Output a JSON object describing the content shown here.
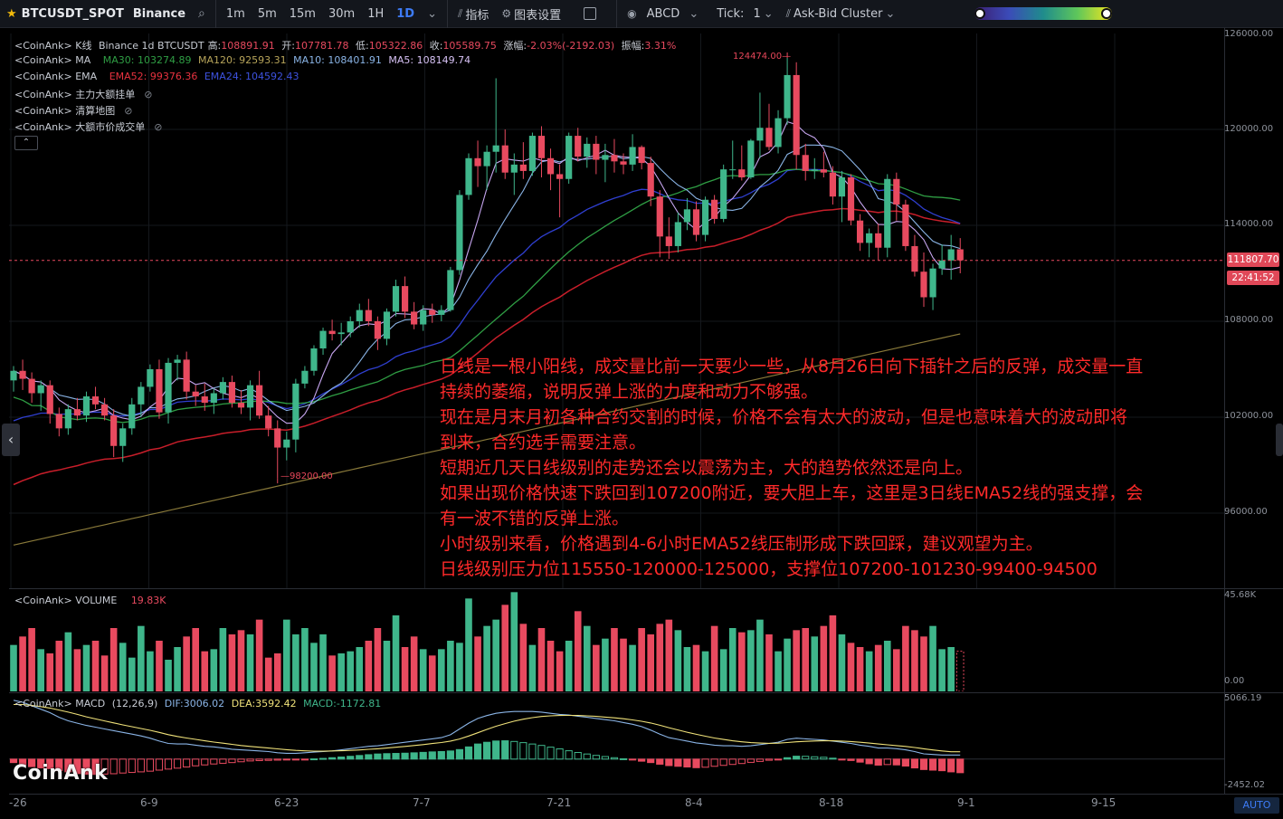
{
  "toolbar": {
    "symbol": "BTCUSDT_SPOT",
    "exchange": "Binance",
    "intervals": [
      "1m",
      "5m",
      "15m",
      "30m",
      "1H",
      "1D"
    ],
    "active_interval": "1D",
    "indicators_label": "指标",
    "chart_settings_label": "图表设置",
    "layout_label": "ABCD",
    "tick_label": "Tick:",
    "tick_value": "1",
    "cluster_label": "Ask-Bid Cluster"
  },
  "legend": {
    "kline": {
      "source": "<CoinAnk> K线",
      "title": "Binance 1d BTCUSDT",
      "high_label": "高:",
      "high": "108891.91",
      "open_label": "开:",
      "open": "107781.78",
      "low_label": "低:",
      "low": "105322.86",
      "close_label": "收:",
      "close": "105589.75",
      "change_label": "涨幅:",
      "change": "-2.03%(-2192.03)",
      "amp_label": "振幅:",
      "amp": "3.31%"
    },
    "ma": {
      "source": "<CoinAnk> MA",
      "ma30": "MA30: 103274.89",
      "ma120": "MA120: 92593.31",
      "ma10": "MA10: 108401.91",
      "ma5": "MA5: 108149.74"
    },
    "ema": {
      "source": "<CoinAnk> EMA",
      "ema52": "EMA52: 99376.36",
      "ema24": "EMA24: 104592.43"
    },
    "hidden": [
      "<CoinAnk> 主力大额挂单",
      "<CoinAnk> 清算地图",
      "<CoinAnk> 大额市价成交单"
    ],
    "volume": {
      "source": "<CoinAnk> VOLUME",
      "value": "19.83K"
    },
    "macd": {
      "source": "<CoinAnk> MACD",
      "params": "(12,26,9)",
      "dif": "DIF:3006.02",
      "dea": "DEA:3592.42",
      "macd": "MACD:-1172.81"
    }
  },
  "price_axis": [
    "126000.00",
    "120000.00",
    "114000.00",
    "108000.00",
    "102000.00",
    "96000.00"
  ],
  "volume_axis": [
    "45.68K",
    "0.00"
  ],
  "macd_axis": [
    "5066.19",
    "-2452.02"
  ],
  "current_price": "111807.70",
  "countdown": "22:41:52",
  "peak_high": "124474.00",
  "trough_low": "98200.00",
  "x_axis": [
    "-26",
    "6-9",
    "6-23",
    "7-7",
    "7-21",
    "8-4",
    "8-18",
    "9-1",
    "9-15"
  ],
  "annotation_lines": [
    "日线是一根小阳线，成交量比前一天要少一些，从8月26日向下插针之后的反弹，成交量一直",
    "持续的萎缩，说明反弹上涨的力度和动力不够强。",
    "现在是月末月初各种合约交割的时候，价格不会有太大的波动，但是也意味着大的波动即将",
    "到来，合约选手需要注意。",
    "短期近几天日线级别的走势还会以震荡为主，大的趋势依然还是向上。",
    "如果出现价格快速下跌回到107200附近，要大胆上车，这里是3日线EMA52线的强支撑，会",
    "有一波不错的反弹上涨。",
    "小时级别来看，价格遇到4-6小时EMA52线压制形成下跌回踩，建议观望为主。",
    "日线级别压力位115550-120000-125000，支撑位107200-101230-99400-94500"
  ],
  "watermark": "CoinAnk",
  "auto_label": "AUTO",
  "colors": {
    "up": "#3fb68b",
    "down": "#e84a5f",
    "ma5": "#c7a6f0",
    "ma10": "#8ab4e6",
    "ma30": "#2f9e44",
    "ma120": "#8a7a3a",
    "ema24": "#2f3fd0",
    "ema52": "#c81e2a",
    "annotation": "#ff2a2a"
  },
  "candles": [
    [
      104300,
      105200,
      103600,
      104900
    ],
    [
      104900,
      105600,
      103700,
      104400
    ],
    [
      104400,
      104800,
      102900,
      103500
    ],
    [
      103500,
      104300,
      102400,
      104000
    ],
    [
      104000,
      104300,
      101600,
      102200
    ],
    [
      102200,
      102600,
      100800,
      101300
    ],
    [
      101300,
      102800,
      100900,
      102500
    ],
    [
      102500,
      103200,
      101800,
      102100
    ],
    [
      102100,
      103600,
      101700,
      103300
    ],
    [
      103300,
      103900,
      102500,
      102800
    ],
    [
      102800,
      103200,
      101800,
      102100
    ],
    [
      102100,
      102500,
      99500,
      100200
    ],
    [
      100200,
      101600,
      99200,
      101300
    ],
    [
      101300,
      103200,
      100900,
      102800
    ],
    [
      102800,
      104200,
      102000,
      103900
    ],
    [
      103900,
      105300,
      103600,
      105000
    ],
    [
      105000,
      105600,
      101900,
      102300
    ],
    [
      102300,
      105700,
      101600,
      105400
    ],
    [
      105400,
      105900,
      104300,
      105600
    ],
    [
      105600,
      106100,
      103100,
      103600
    ],
    [
      103600,
      104000,
      102700,
      103300
    ],
    [
      103300,
      104100,
      102400,
      102900
    ],
    [
      102900,
      103800,
      102200,
      103500
    ],
    [
      103500,
      104500,
      103100,
      104200
    ],
    [
      104200,
      104600,
      102600,
      102900
    ],
    [
      102900,
      103700,
      102200,
      102600
    ],
    [
      102600,
      104300,
      101800,
      104000
    ],
    [
      104000,
      104900,
      101900,
      102100
    ],
    [
      102100,
      102700,
      100800,
      101300
    ],
    [
      101300,
      101800,
      98200,
      100100
    ],
    [
      100100,
      101100,
      99300,
      100600
    ],
    [
      100600,
      104400,
      99800,
      104100
    ],
    [
      104100,
      105200,
      103800,
      104900
    ],
    [
      104900,
      106500,
      104600,
      106300
    ],
    [
      106300,
      107600,
      105900,
      107400
    ],
    [
      107400,
      108100,
      106800,
      107200
    ],
    [
      107200,
      107900,
      106500,
      107300
    ],
    [
      107300,
      108300,
      107000,
      108000
    ],
    [
      108000,
      109100,
      107600,
      108700
    ],
    [
      108700,
      109400,
      107700,
      108000
    ],
    [
      108000,
      108300,
      106200,
      106900
    ],
    [
      106900,
      108800,
      106500,
      108600
    ],
    [
      108600,
      110600,
      108300,
      110200
    ],
    [
      110200,
      110800,
      108200,
      108600
    ],
    [
      108600,
      109200,
      107500,
      107800
    ],
    [
      107800,
      109000,
      107400,
      108700
    ],
    [
      108700,
      109100,
      107900,
      108400
    ],
    [
      108400,
      109000,
      108000,
      108700
    ],
    [
      108700,
      111400,
      108600,
      111200
    ],
    [
      111200,
      116200,
      110900,
      115900
    ],
    [
      115900,
      118500,
      115600,
      118200
    ],
    [
      118200,
      119300,
      116400,
      117700
    ],
    [
      117700,
      119000,
      116200,
      118600
    ],
    [
      118600,
      123200,
      117300,
      119000
    ],
    [
      119000,
      120000,
      116900,
      117300
    ],
    [
      117300,
      118500,
      115900,
      117800
    ],
    [
      117800,
      119200,
      116900,
      117400
    ],
    [
      117400,
      119800,
      117100,
      119600
    ],
    [
      119600,
      120200,
      117000,
      118200
    ],
    [
      118200,
      118800,
      116200,
      117200
    ],
    [
      117200,
      117800,
      114500,
      116900
    ],
    [
      116900,
      119800,
      116600,
      119600
    ],
    [
      119600,
      120100,
      118000,
      118300
    ],
    [
      118300,
      119500,
      117600,
      119100
    ],
    [
      119100,
      119600,
      117200,
      118100
    ],
    [
      118100,
      119100,
      116700,
      118400
    ],
    [
      118400,
      119400,
      117300,
      118000
    ],
    [
      118000,
      118500,
      117200,
      117800
    ],
    [
      117800,
      119700,
      117400,
      118900
    ],
    [
      118900,
      119000,
      117500,
      117900
    ],
    [
      117900,
      118300,
      115200,
      115800
    ],
    [
      115800,
      116200,
      112000,
      113300
    ],
    [
      113300,
      114500,
      111900,
      112700
    ],
    [
      112700,
      114800,
      112300,
      114200
    ],
    [
      114200,
      115700,
      113700,
      115000
    ],
    [
      115000,
      115500,
      113000,
      113400
    ],
    [
      113400,
      115800,
      113000,
      115600
    ],
    [
      115600,
      115900,
      114100,
      114400
    ],
    [
      114400,
      117800,
      114200,
      117500
    ],
    [
      117500,
      119300,
      116900,
      117500
    ],
    [
      117500,
      119000,
      116800,
      117000
    ],
    [
      117000,
      119400,
      116900,
      119300
    ],
    [
      119300,
      122300,
      118200,
      120100
    ],
    [
      120100,
      121600,
      118700,
      118900
    ],
    [
      118900,
      121200,
      118500,
      120700
    ],
    [
      120700,
      124474,
      120300,
      123400
    ],
    [
      123400,
      124200,
      117500,
      118400
    ],
    [
      118400,
      119100,
      116800,
      117400
    ],
    [
      117400,
      118200,
      116900,
      117500
    ],
    [
      117500,
      118600,
      117000,
      117300
    ],
    [
      117300,
      117700,
      115300,
      115800
    ],
    [
      115800,
      117400,
      114200,
      117000
    ],
    [
      117000,
      117200,
      114000,
      114300
    ],
    [
      114300,
      114700,
      112400,
      112900
    ],
    [
      112900,
      113800,
      112000,
      113500
    ],
    [
      113500,
      114100,
      111800,
      112600
    ],
    [
      112600,
      117200,
      112000,
      116900
    ],
    [
      116900,
      117300,
      114300,
      115300
    ],
    [
      115300,
      115600,
      112400,
      112700
    ],
    [
      112700,
      113400,
      110800,
      111100
    ],
    [
      111100,
      112300,
      108900,
      109500
    ],
    [
      109500,
      111600,
      108700,
      111300
    ],
    [
      111300,
      112800,
      110900,
      111800
    ],
    [
      111800,
      113400,
      110600,
      112500
    ],
    [
      112500,
      113200,
      111000,
      111808
    ]
  ],
  "volumes": [
    22,
    26,
    30,
    20,
    18,
    24,
    28,
    20,
    22,
    24,
    17,
    30,
    23,
    16,
    31,
    19,
    24,
    15,
    21,
    26,
    30,
    19,
    20,
    30,
    27,
    29,
    27,
    34,
    16,
    18,
    34,
    27,
    30,
    23,
    27,
    17,
    18,
    19,
    21,
    24,
    30,
    24,
    36,
    21,
    26,
    20,
    17,
    20,
    24,
    23,
    44,
    26,
    31,
    34,
    41,
    47,
    32,
    22,
    30,
    24,
    19,
    24,
    38,
    31,
    22,
    25,
    30,
    25,
    22,
    30,
    27,
    32,
    34,
    29,
    21,
    22,
    19,
    31,
    20,
    30,
    28,
    29,
    34,
    27,
    19,
    25,
    29,
    30,
    26,
    31,
    36,
    27,
    23,
    21,
    19,
    22,
    24,
    20,
    31,
    29,
    26,
    31,
    20,
    21,
    19
  ],
  "macd": [
    [
      5066,
      4700,
      -300
    ],
    [
      4900,
      4700,
      -500
    ],
    [
      4600,
      4620,
      -650
    ],
    [
      4300,
      4520,
      -760
    ],
    [
      4000,
      4400,
      -820
    ],
    [
      3600,
      4230,
      -1000
    ],
    [
      3300,
      4050,
      -1100
    ],
    [
      3100,
      3850,
      -1250
    ],
    [
      2900,
      3640,
      -1300
    ],
    [
      2750,
      3460,
      -1320
    ],
    [
      2600,
      3290,
      -1290
    ],
    [
      2450,
      3120,
      -1260
    ],
    [
      2300,
      2950,
      -1200
    ],
    [
      2150,
      2790,
      -1150
    ],
    [
      2000,
      2640,
      -1100
    ],
    [
      1800,
      2480,
      -1040
    ],
    [
      1550,
      2300,
      -950
    ],
    [
      1350,
      2110,
      -860
    ],
    [
      1300,
      1950,
      -780
    ],
    [
      1300,
      1820,
      -680
    ],
    [
      1200,
      1700,
      -580
    ],
    [
      1100,
      1580,
      -500
    ],
    [
      1050,
      1470,
      -420
    ],
    [
      950,
      1370,
      -360
    ],
    [
      850,
      1270,
      -300
    ],
    [
      800,
      1170,
      -230
    ],
    [
      750,
      1090,
      -160
    ],
    [
      700,
      1020,
      -130
    ],
    [
      650,
      950,
      -110
    ],
    [
      550,
      880,
      -90
    ],
    [
      500,
      810,
      -60
    ],
    [
      500,
      750,
      -40
    ],
    [
      550,
      710,
      -20
    ],
    [
      600,
      690,
      20
    ],
    [
      650,
      680,
      60
    ],
    [
      700,
      700,
      120
    ],
    [
      800,
      720,
      180
    ],
    [
      900,
      750,
      240
    ],
    [
      1000,
      790,
      310
    ],
    [
      1100,
      840,
      380
    ],
    [
      1150,
      890,
      440
    ],
    [
      1250,
      950,
      470
    ],
    [
      1350,
      1020,
      490
    ],
    [
      1450,
      1090,
      510
    ],
    [
      1550,
      1170,
      540
    ],
    [
      1650,
      1250,
      580
    ],
    [
      1750,
      1340,
      620
    ],
    [
      1850,
      1430,
      650
    ],
    [
      2100,
      1550,
      700
    ],
    [
      2600,
      1730,
      820
    ],
    [
      3100,
      1990,
      1050
    ],
    [
      3500,
      2270,
      1300
    ],
    [
      3750,
      2560,
      1450
    ],
    [
      3950,
      2830,
      1560
    ],
    [
      4050,
      3060,
      1580
    ],
    [
      4100,
      3270,
      1520
    ],
    [
      4100,
      3440,
      1420
    ],
    [
      4100,
      3570,
      1300
    ],
    [
      4050,
      3670,
      1180
    ],
    [
      3950,
      3730,
      1030
    ],
    [
      3850,
      3760,
      880
    ],
    [
      3800,
      3770,
      720
    ],
    [
      3700,
      3760,
      570
    ],
    [
      3600,
      3730,
      440
    ],
    [
      3500,
      3680,
      320
    ],
    [
      3400,
      3620,
      220
    ],
    [
      3300,
      3560,
      120
    ],
    [
      3150,
      3480,
      30
    ],
    [
      3000,
      3380,
      -80
    ],
    [
      2800,
      3260,
      -180
    ],
    [
      2500,
      3110,
      -300
    ],
    [
      2150,
      2920,
      -440
    ],
    [
      1850,
      2710,
      -560
    ],
    [
      1700,
      2510,
      -620
    ],
    [
      1550,
      2320,
      -680
    ],
    [
      1400,
      2140,
      -740
    ],
    [
      1300,
      1970,
      -700
    ],
    [
      1200,
      1820,
      -620
    ],
    [
      1150,
      1690,
      -540
    ],
    [
      1150,
      1580,
      -460
    ],
    [
      1100,
      1490,
      -380
    ],
    [
      1150,
      1420,
      -280
    ],
    [
      1250,
      1380,
      -200
    ],
    [
      1350,
      1360,
      -100
    ],
    [
      1450,
      1370,
      -10
    ],
    [
      1700,
      1430,
      120
    ],
    [
      1800,
      1490,
      250
    ],
    [
      1750,
      1530,
      240
    ],
    [
      1700,
      1560,
      200
    ],
    [
      1650,
      1580,
      160
    ],
    [
      1550,
      1580,
      80
    ],
    [
      1450,
      1550,
      -20
    ],
    [
      1350,
      1510,
      -120
    ],
    [
      1200,
      1450,
      -260
    ],
    [
      1100,
      1380,
      -400
    ],
    [
      950,
      1300,
      -520
    ],
    [
      950,
      1230,
      -470
    ],
    [
      900,
      1160,
      -500
    ],
    [
      800,
      1090,
      -600
    ],
    [
      650,
      1000,
      -760
    ],
    [
      450,
      890,
      -900
    ],
    [
      400,
      790,
      -950
    ],
    [
      350,
      700,
      -1000
    ],
    [
      350,
      630,
      -1100
    ],
    [
      3006,
      3592,
      -1172
    ]
  ]
}
